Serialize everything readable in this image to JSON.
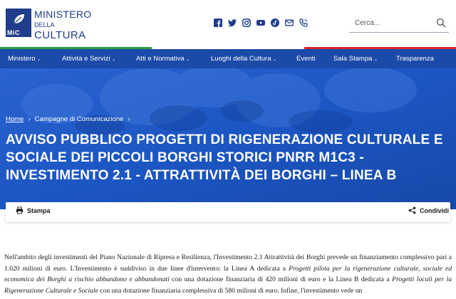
{
  "header": {
    "logo": {
      "line1": "MINISTERO",
      "line2": "DELLA",
      "line3": "CULTURA",
      "badge": "MiC"
    },
    "social_icons": [
      "facebook-icon",
      "twitter-icon",
      "instagram-icon",
      "youtube-icon",
      "tiktok-icon",
      "mail-icon",
      "phone-icon"
    ],
    "search": {
      "placeholder": "Cerca..."
    }
  },
  "nav": {
    "items": [
      {
        "label": "Ministero"
      },
      {
        "label": "Attività e Servizi"
      },
      {
        "label": "Atti e Normativa"
      },
      {
        "label": "Luoghi della Cultura"
      },
      {
        "label": "Eventi"
      },
      {
        "label": "Sala Stampa"
      },
      {
        "label": "Trasparenza"
      }
    ]
  },
  "breadcrumb": {
    "home": "Home",
    "current": "Campagne di Comunicazione"
  },
  "page_title": "AVVISO PUBBLICO PROGETTI DI RIGENERAZIONE CULTURALE E SOCIALE DEI PICCOLI BORGHI STORICI PNRR M1C3 - INVESTIMENTO 2.1 - ATTRATTIVITÀ DEI BORGHI – LINEA B",
  "actions": {
    "print_label": "Stampa",
    "share_label": "Condividi"
  },
  "body": {
    "p1": "Nell'ambito degli investimenti del Piano Nazionale di Ripresa e Resilienza, l'Investimento 2.1 Attrattività dei Borghi prevede un finanziamento complessivo pari a 1.020 milioni di euro. L'Investimento è suddiviso in due linee d'intervento: la Linea A dedicata a ",
    "em1": "Progetti pilota per la rigenerazione culturale, sociale ed economica dei Borghi a rischio abbandono e abbandonati",
    "p2": " con una dotazione finanziaria di 420 milioni di euro e la Linea B dedicata a ",
    "em2": "Progetti locali per la Rigenerazione Culturale e Sociale",
    "p3": " con una dotazione finanziaria complessiva di 580 milioni di euro. Infine, l'investimento vede un"
  },
  "colors": {
    "brand_blue": "#1f3d8a",
    "nav_blue": "#1b4aa8",
    "hero_blue": "#1c56c3",
    "green": "#2e9b48",
    "red": "#d8262f"
  }
}
